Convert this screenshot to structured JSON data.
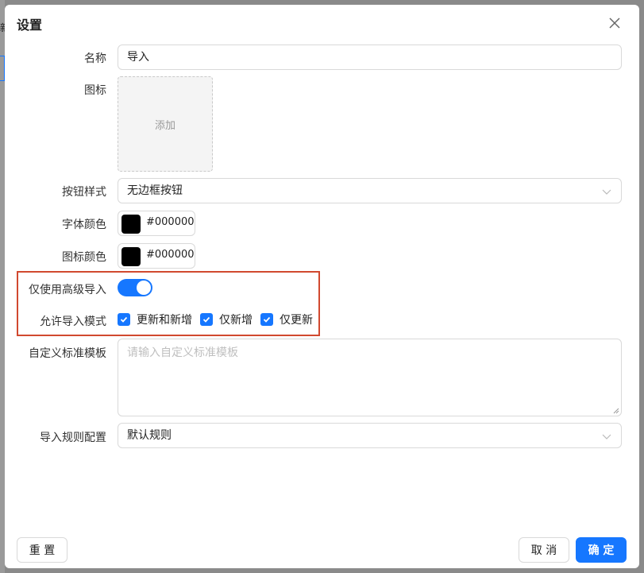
{
  "dialog": {
    "title": "设置"
  },
  "form": {
    "name": {
      "label": "名称",
      "value": "导入"
    },
    "icon": {
      "label": "图标",
      "upload_label": "添加"
    },
    "button_style": {
      "label": "按钮样式",
      "value": "无边框按钮"
    },
    "font_color": {
      "label": "字体颜色",
      "value": "#000000"
    },
    "icon_color": {
      "label": "图标颜色",
      "value": "#000000"
    },
    "advanced_import": {
      "label": "仅使用高级导入",
      "on": true
    },
    "import_modes": {
      "label": "允许导入模式",
      "options": [
        {
          "label": "更新和新增",
          "checked": true
        },
        {
          "label": "仅新增",
          "checked": true
        },
        {
          "label": "仅更新",
          "checked": true
        }
      ]
    },
    "template": {
      "label": "自定义标准模板",
      "placeholder": "请输入自定义标准模板"
    },
    "rule_config": {
      "label": "导入规则配置",
      "value": "默认规则"
    }
  },
  "footer": {
    "reset": "重 置",
    "cancel": "取 消",
    "confirm": "确 定"
  },
  "background": {
    "partial_text": "新"
  },
  "colors": {
    "accent": "#1677ff",
    "highlight": "#d1492f",
    "swatch": "#000000"
  },
  "icons": {
    "close": "close-icon",
    "select_arrow": "chevron-down-icon",
    "check": "check-icon"
  }
}
